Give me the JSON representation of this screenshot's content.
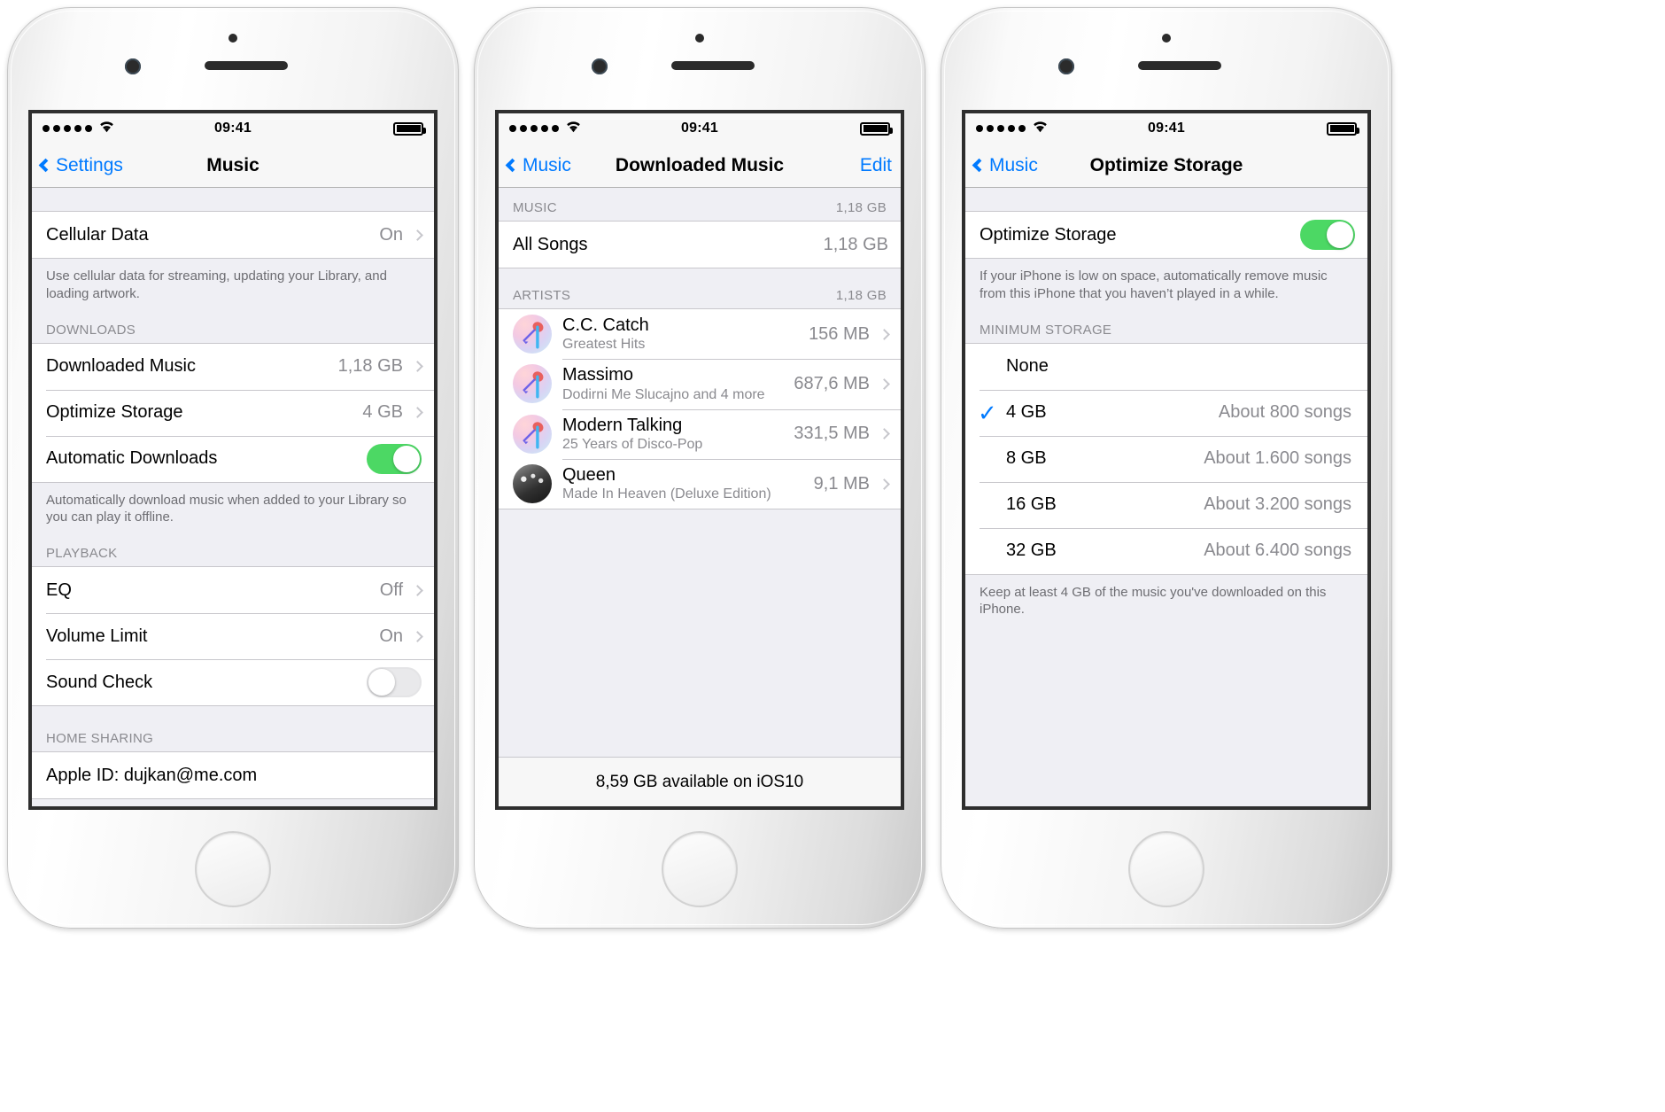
{
  "status_bar": {
    "time": "09:41",
    "signal_dots": 5,
    "wifi_icon": "wifi-icon",
    "battery_icon": "battery-full-icon"
  },
  "screen1": {
    "nav": {
      "back_label": "Settings",
      "title": "Music",
      "back_icon": "chevron-left-icon"
    },
    "cellular": {
      "label": "Cellular Data",
      "value": "On",
      "footnote": "Use cellular data for streaming, updating your Library, and loading artwork."
    },
    "downloads_header": "DOWNLOADS",
    "downloads": [
      {
        "label": "Downloaded Music",
        "value": "1,18 GB",
        "type": "disclosure"
      },
      {
        "label": "Optimize Storage",
        "value": "4 GB",
        "type": "disclosure"
      },
      {
        "label": "Automatic Downloads",
        "value": "",
        "type": "switch",
        "switch_on": true
      }
    ],
    "downloads_footnote": "Automatically download music when added to your Library so you can play it offline.",
    "playback_header": "PLAYBACK",
    "playback": [
      {
        "label": "EQ",
        "value": "Off",
        "type": "disclosure"
      },
      {
        "label": "Volume Limit",
        "value": "On",
        "type": "disclosure"
      },
      {
        "label": "Sound Check",
        "value": "",
        "type": "switch",
        "switch_on": false
      }
    ],
    "home_sharing_header": "HOME SHARING",
    "home_sharing_link": "Apple ID: dujkan@me.com"
  },
  "screen2": {
    "nav": {
      "back_label": "Music",
      "title": "Downloaded Music",
      "right_label": "Edit",
      "back_icon": "chevron-left-icon"
    },
    "music_header": {
      "label": "MUSIC",
      "value": "1,18 GB"
    },
    "all_songs": {
      "label": "All Songs",
      "value": "1,18 GB"
    },
    "artists_header": {
      "label": "ARTISTS",
      "value": "1,18 GB"
    },
    "artists": [
      {
        "name": "C.C. Catch",
        "album": "Greatest Hits",
        "size": "156 MB",
        "avatar": "microphone-avatar"
      },
      {
        "name": "Massimo",
        "album": "Dodirni Me Slucajno and 4 more",
        "size": "687,6 MB",
        "avatar": "microphone-avatar"
      },
      {
        "name": "Modern Talking",
        "album": "25 Years of Disco-Pop",
        "size": "331,5 MB",
        "avatar": "microphone-avatar"
      },
      {
        "name": "Queen",
        "album": "Made In Heaven (Deluxe Edition)",
        "size": "9,1 MB",
        "avatar": "band-photo-avatar"
      }
    ],
    "bottom_bar": "8,59 GB available on iOS10"
  },
  "screen3": {
    "nav": {
      "back_label": "Music",
      "title": "Optimize Storage",
      "back_icon": "chevron-left-icon"
    },
    "toggle": {
      "label": "Optimize Storage",
      "switch_on": true
    },
    "toggle_footnote": "If your iPhone is low on space, automatically remove music from this iPhone that you haven’t played in a while.",
    "minimum_header": "MINIMUM STORAGE",
    "options": [
      {
        "label": "None",
        "detail": "",
        "checked": false
      },
      {
        "label": "4 GB",
        "detail": "About 800 songs",
        "checked": true
      },
      {
        "label": "8 GB",
        "detail": "About 1.600 songs",
        "checked": false
      },
      {
        "label": "16 GB",
        "detail": "About 3.200 songs",
        "checked": false
      },
      {
        "label": "32 GB",
        "detail": "About 6.400 songs",
        "checked": false
      }
    ],
    "options_footnote": "Keep at least 4 GB of the music you've downloaded on this iPhone."
  },
  "colors": {
    "accent": "#007aff",
    "switch_on": "#4cd864",
    "secondary_text": "#8a8a8f",
    "separator": "#c8c7cc",
    "group_bg": "#efeff4"
  }
}
